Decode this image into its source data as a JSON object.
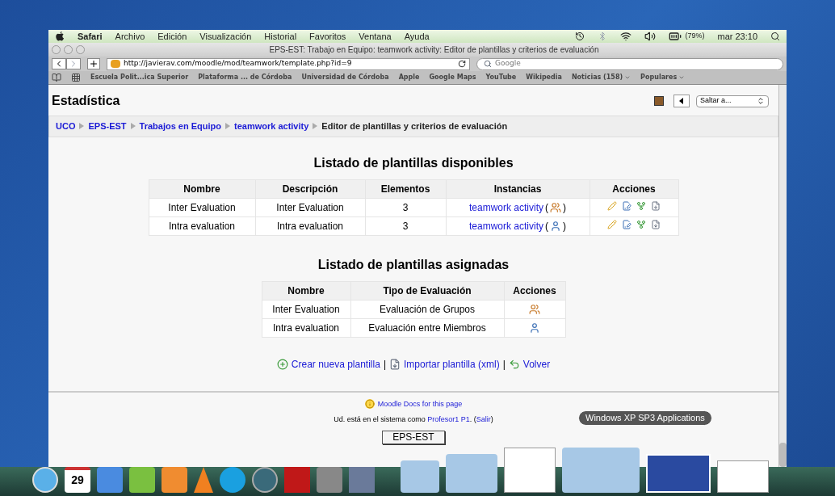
{
  "menubar": {
    "items": [
      {
        "label": "Safari",
        "bold": true
      },
      {
        "label": "Archivo",
        "bold": false
      },
      {
        "label": "Edición",
        "bold": false
      },
      {
        "label": "Visualización",
        "bold": false
      },
      {
        "label": "Historial",
        "bold": false
      },
      {
        "label": "Favoritos",
        "bold": false
      },
      {
        "label": "Ventana",
        "bold": false
      },
      {
        "label": "Ayuda",
        "bold": false
      }
    ],
    "battery": "(79%)",
    "clock": "mar 23:10"
  },
  "window": {
    "title": "EPS-EST: Trabajo en Equipo: teamwork activity: Editor de plantillas y criterios de evaluación"
  },
  "toolbar": {
    "url": "http://javierav.com/moodle/mod/teamwork/template.php?id=9",
    "search_placeholder": "Google"
  },
  "bookmarks": [
    {
      "label": "Escuela Polit...ica Superior",
      "menu": false
    },
    {
      "label": "Plataforma ... de Córdoba",
      "menu": false
    },
    {
      "label": "Universidad de Córdoba",
      "menu": false
    },
    {
      "label": "Apple",
      "menu": false
    },
    {
      "label": "Google Maps",
      "menu": false
    },
    {
      "label": "YouTube",
      "menu": false
    },
    {
      "label": "Wikipedia",
      "menu": false
    },
    {
      "label": "Noticias (158)",
      "menu": true
    },
    {
      "label": "Populares",
      "menu": true
    }
  ],
  "page": {
    "heading": "Estadística",
    "jump": "Saltar a...",
    "breadcrumb": [
      {
        "label": "UCO",
        "link": true
      },
      {
        "label": "EPS-EST",
        "link": true
      },
      {
        "label": "Trabajos en Equipo",
        "link": true
      },
      {
        "label": "teamwork activity",
        "link": true
      },
      {
        "label": "Editor de plantillas y criterios de evaluación",
        "link": false
      }
    ],
    "available": {
      "title": "Listado de plantillas disponibles",
      "columns": [
        "Nombre",
        "Descripción",
        "Elementos",
        "Instancias",
        "Acciones"
      ],
      "rows": [
        {
          "name": "Inter Evaluation",
          "description": "Inter Evaluation",
          "elements": "3",
          "instance": "teamwork activity",
          "open": "(",
          "close": ")",
          "kind": "group"
        },
        {
          "name": "Intra evaluation",
          "description": "Intra evaluation",
          "elements": "3",
          "instance": "teamwork activity",
          "open": "(",
          "close": ")",
          "kind": "member"
        }
      ]
    },
    "assigned": {
      "title": "Listado de plantillas asignadas",
      "columns": [
        "Nombre",
        "Tipo de Evaluación",
        "Acciones"
      ],
      "rows": [
        {
          "name": "Inter Evaluation",
          "type": "Evaluación de Grupos",
          "kind": "group"
        },
        {
          "name": "Intra evaluation",
          "type": "Evaluación entre Miembros",
          "kind": "member"
        }
      ]
    },
    "links": {
      "separator": "|",
      "items": [
        {
          "label": "Crear nueva plantilla",
          "kind": "add"
        },
        {
          "label": "Importar plantilla (xml)",
          "kind": "import"
        },
        {
          "label": "Volver",
          "kind": "back"
        }
      ]
    },
    "footer": {
      "docs": "Moodle Docs for this page",
      "login": [
        {
          "text": "Ud. está en el sistema como ",
          "link": false
        },
        {
          "text": "Profesor1 P1",
          "link": true
        },
        {
          "text": ". (",
          "link": false
        },
        {
          "text": "Salir",
          "link": true
        },
        {
          "text": ")",
          "link": false
        }
      ],
      "course_button": "EPS-EST"
    }
  },
  "dock": {
    "tooltip": "Windows XP SP3 Applications",
    "calendar_day": "29"
  }
}
